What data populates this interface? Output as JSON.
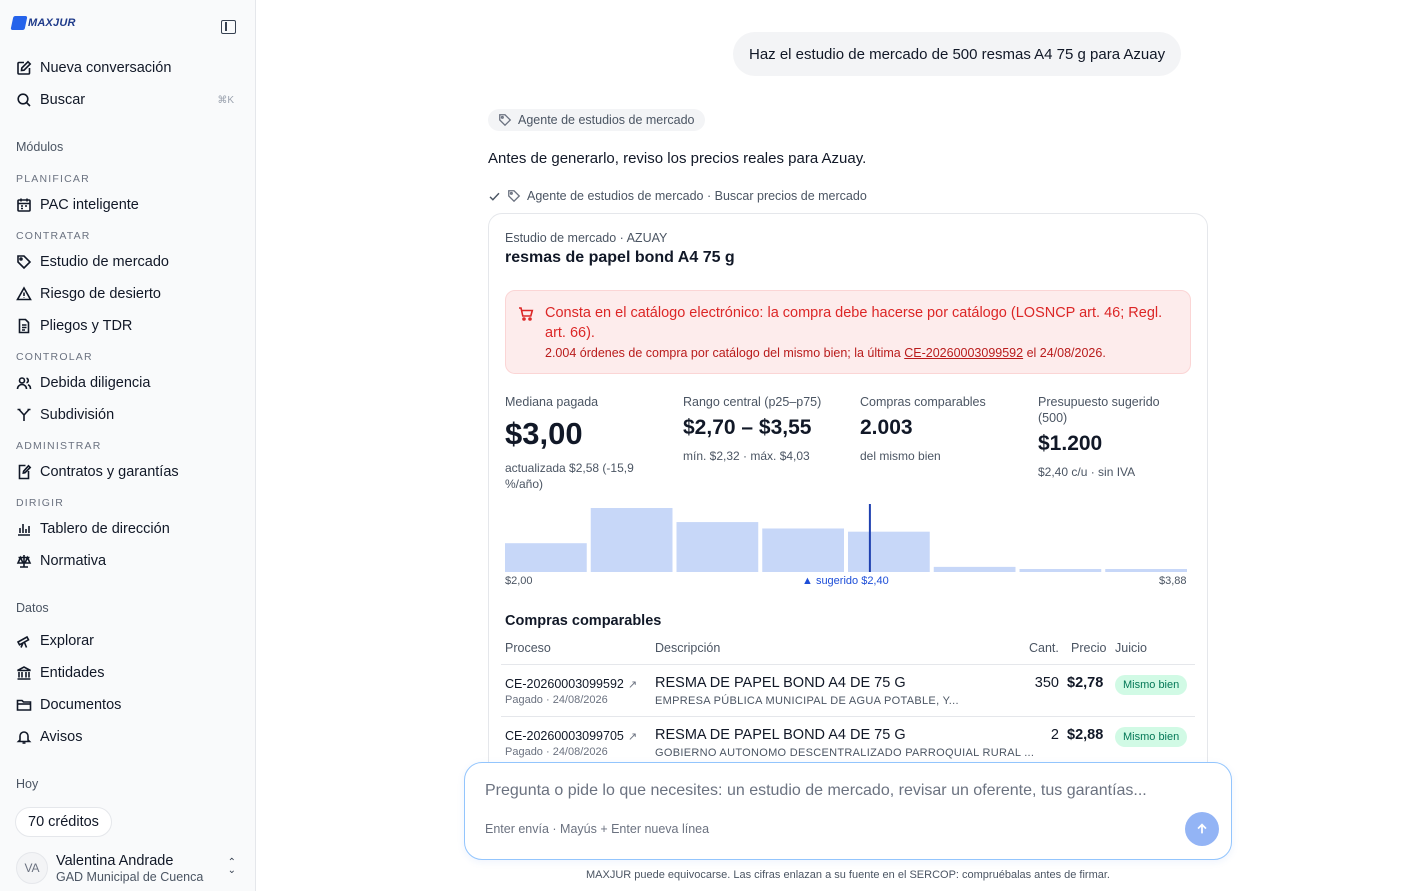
{
  "sidebar": {
    "logo_text": "MAXJUR",
    "new_chat": "Nueva conversación",
    "search": "Buscar",
    "search_kbd": "⌘K",
    "modules_title": "Módulos",
    "groups": {
      "plan": "PLANIFICAR",
      "contract": "CONTRATAR",
      "control": "CONTROLAR",
      "admin": "ADMINISTRAR",
      "direct": "DIRIGIR"
    },
    "items": {
      "pac": "PAC inteligente",
      "estudio": "Estudio de mercado",
      "riesgo": "Riesgo de desierto",
      "pliegos": "Pliegos y TDR",
      "debida": "Debida diligencia",
      "subdivision": "Subdivisión",
      "contratos": "Contratos y garantías",
      "tablero": "Tablero de dirección",
      "normativa": "Normativa"
    },
    "data_title": "Datos",
    "data_items": {
      "explorar": "Explorar",
      "entidades": "Entidades",
      "documentos": "Documentos",
      "avisos": "Avisos"
    },
    "today_title": "Hoy",
    "credits": "70 créditos",
    "user": {
      "initials": "VA",
      "name": "Valentina Andrade",
      "org": "GAD Municipal de Cuenca"
    }
  },
  "chat": {
    "user_message": "Haz el estudio de mercado de 500 resmas A4 75 g para Azuay",
    "agent_chip": "Agente de estudios de mercado",
    "intro": "Antes de generarlo, reviso los precios reales para Azuay.",
    "step": "Agente de estudios de mercado · Buscar precios de mercado"
  },
  "card": {
    "subtitle": "Estudio de mercado · AZUAY",
    "title": "resmas de papel bond A4 75 g",
    "alert": {
      "main": "Consta en el catálogo electrónico: la compra debe hacerse por catálogo (LOSNCP art. 46; Regl. art. 66).",
      "sub_prefix": "2.004 órdenes de compra por catálogo del mismo bien; la última ",
      "sub_link": "CE-20260003099592",
      "sub_suffix": " el 24/08/2026."
    },
    "stats": [
      {
        "label": "Mediana pagada",
        "value": "$3,00",
        "note": "actualizada $2,58 (-15,9 %/año)"
      },
      {
        "label": "Rango central (p25–p75)",
        "value": "$2,70 – $3,55",
        "note": "mín. $2,32 · máx. $4,03"
      },
      {
        "label": "Compras comparables",
        "value": "2.003",
        "note": "del mismo bien"
      },
      {
        "label": "Presupuesto sugerido (500)",
        "value": "$1.200",
        "note": "$2,40 c/u · sin IVA"
      }
    ],
    "table": {
      "title": "Compras comparables",
      "headers": {
        "proceso": "Proceso",
        "descripcion": "Descripción",
        "cant": "Cant.",
        "precio": "Precio",
        "juicio": "Juicio"
      },
      "rows": [
        {
          "proceso": "CE-20260003099592",
          "proceso_sub": "Pagado · 24/08/2026",
          "descripcion": "RESMA DE PAPEL BOND A4 DE 75 G",
          "descripcion_sub": "EMPRESA PÚBLICA MUNICIPAL DE AGUA POTABLE, Y...",
          "cant": "350",
          "precio": "$2,78",
          "juicio": "Mismo bien"
        },
        {
          "proceso": "CE-20260003099705",
          "proceso_sub": "Pagado · 24/08/2026",
          "descripcion": "RESMA DE PAPEL BOND A4 DE 75 G",
          "descripcion_sub": "GOBIERNO AUTONOMO DESCENTRALIZADO PARROQUIAL RURAL ...",
          "cant": "2",
          "precio": "$2,88",
          "juicio": "Mismo bien"
        }
      ]
    }
  },
  "chart_data": {
    "type": "bar",
    "title": "",
    "x_min_label": "$2,00",
    "x_max_label": "$3,88",
    "marker_label": "▲ sugerido $2,40",
    "x_range": [
      2.0,
      3.88
    ],
    "marker_value": 2.4,
    "median_value": 3.0,
    "bar_color": "#c7d7f8",
    "median_color": "#1e40af",
    "bins": [
      {
        "from": 2.0,
        "to": 2.235,
        "value": 45
      },
      {
        "from": 2.235,
        "to": 2.47,
        "value": 100
      },
      {
        "from": 2.47,
        "to": 2.705,
        "value": 78
      },
      {
        "from": 2.705,
        "to": 2.94,
        "value": 68
      },
      {
        "from": 2.94,
        "to": 3.175,
        "value": 63
      },
      {
        "from": 3.175,
        "to": 3.41,
        "value": 8
      },
      {
        "from": 3.41,
        "to": 3.645,
        "value": 4
      },
      {
        "from": 3.645,
        "to": 3.88,
        "value": 4
      }
    ]
  },
  "composer": {
    "placeholder": "Pregunta o pide lo que necesites: un estudio de mercado, revisar un oferente, tus garantías...",
    "hint": "Enter envía · Mayús + Enter nueva línea",
    "send_icon": "arrow-up-icon"
  },
  "footer": "MAXJUR puede equivocarse. Las cifras enlazan a su fuente en el SERCOP: compruébalas antes de firmar."
}
